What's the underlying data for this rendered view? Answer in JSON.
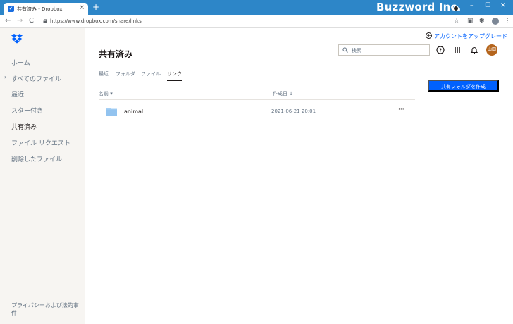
{
  "browser": {
    "tab_title": "共有済み - Dropbox",
    "tab_favicon": "dropbox-icon",
    "tab_close": "×",
    "new_tab": "+",
    "window_brand": "Buzzword Inc.",
    "minimize": "–",
    "maximize": "☐",
    "close": "✕",
    "url": "https://www.dropbox.com/share/links",
    "nav": {
      "back": "←",
      "forward": "→",
      "reload": "C"
    },
    "toolbar_icons": [
      "star-icon",
      "extension-icon",
      "puzzle-icon",
      "profile-icon",
      "menu-icon"
    ]
  },
  "sidebar": {
    "logo": "dropbox-logo-icon",
    "items": [
      {
        "label": "ホーム",
        "active": false,
        "expandable": false
      },
      {
        "label": "すべてのファイル",
        "active": false,
        "expandable": true
      },
      {
        "label": "最近",
        "active": false,
        "expandable": false
      },
      {
        "label": "スター付き",
        "active": false,
        "expandable": false
      },
      {
        "label": "共有済み",
        "active": true,
        "expandable": false
      },
      {
        "label": "ファイル リクエスト",
        "active": false,
        "expandable": false
      },
      {
        "label": "削除したファイル",
        "active": false,
        "expandable": false
      }
    ],
    "footer": "プライバシーおよび法的事件"
  },
  "header": {
    "upgrade_label": "アカウントをアップグレード",
    "upgrade_icon": "+",
    "page_title": "共有済み",
    "search_placeholder": "検索",
    "help_icon": "help-icon",
    "apps_icon": "grid-icon",
    "bell_icon": "bell-icon",
    "avatar_text": "山田"
  },
  "filter_tabs": [
    {
      "label": "最近",
      "active": false
    },
    {
      "label": "フォルダ",
      "active": false
    },
    {
      "label": "ファイル",
      "active": false
    },
    {
      "label": "リンク",
      "active": true
    }
  ],
  "create_button": "共有フォルダを作成",
  "table": {
    "columns": [
      {
        "label": "名前 ▾"
      },
      {
        "label": "作成日 ↓"
      }
    ],
    "rows": [
      {
        "name": "animal",
        "created": "2021-06-21 20:01",
        "more": "···",
        "icon": "folder-icon"
      }
    ]
  },
  "colors": {
    "accent": "#0061fe",
    "titlebar": "#2d86c8",
    "sidebar_bg": "#f7f5f2",
    "folder": "#a7d0f5"
  }
}
